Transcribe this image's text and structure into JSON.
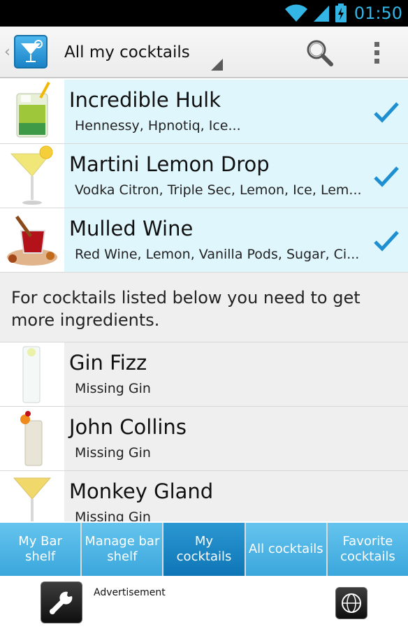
{
  "status_bar": {
    "time": "01:50",
    "accent": "#33b5e5"
  },
  "action_bar": {
    "title": "All my cocktails",
    "search_icon": "search-icon",
    "overflow_icon": "overflow-menu-icon"
  },
  "available_cocktails": [
    {
      "name": "Incredible Hulk",
      "ingredients": "Hennessy, Hpnotiq, Ice...",
      "checked": true
    },
    {
      "name": "Martini Lemon Drop",
      "ingredients": "Vodka Citron, Triple Sec, Lemon, Ice, Lem...",
      "checked": true
    },
    {
      "name": "Mulled Wine",
      "ingredients": "Red Wine, Lemon, Vanilla Pods, Sugar, Ci...",
      "checked": true
    }
  ],
  "missing_note": "For cocktails listed below you need to get more ingredients.",
  "missing_cocktails": [
    {
      "name": "Gin Fizz",
      "ingredients": "Missing Gin"
    },
    {
      "name": "John Collins",
      "ingredients": "Missing Gin"
    },
    {
      "name": "Monkey Gland",
      "ingredients": "Missing Gin"
    }
  ],
  "tabs": [
    {
      "label": "My Bar shelf",
      "active": false
    },
    {
      "label": "Manage bar shelf",
      "active": false
    },
    {
      "label": "My cocktails",
      "active": true
    },
    {
      "label": "All cocktails",
      "active": false
    },
    {
      "label": "Favorite cocktails",
      "active": false
    }
  ],
  "ad": {
    "label": "Advertisement"
  },
  "colors": {
    "have_row_bg": "#dff6fd",
    "check": "#1e8fd0",
    "tab": "#3ba7dc",
    "tab_active": "#0f76b6"
  }
}
